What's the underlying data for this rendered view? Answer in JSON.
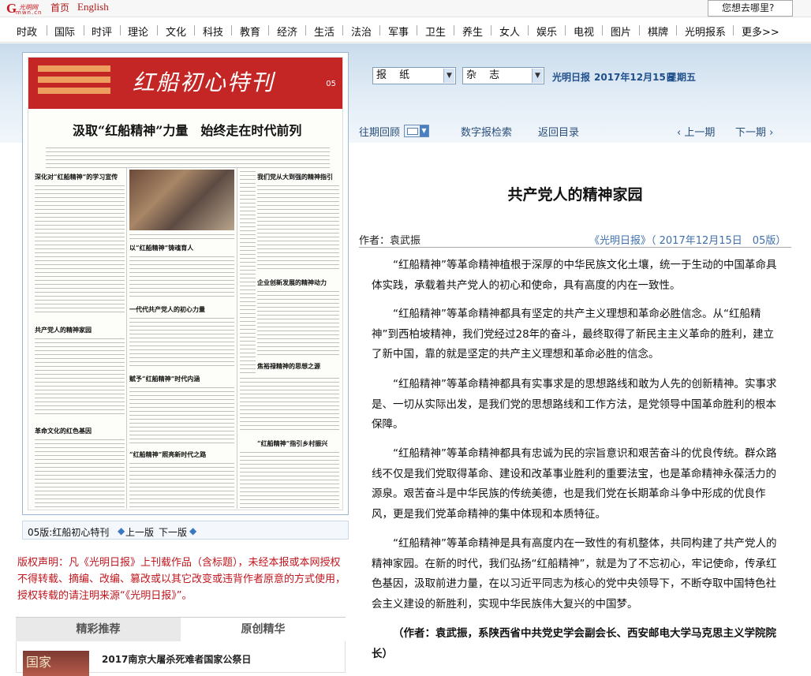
{
  "top": {
    "home": "首页",
    "english": "English",
    "search_placeholder": "您想去哪里?"
  },
  "nav": [
    "时政",
    "国际",
    "时评",
    "理论",
    "文化",
    "科技",
    "教育",
    "经济",
    "生活",
    "法治",
    "军事",
    "卫生",
    "养生",
    "女人",
    "娱乐",
    "电视",
    "图片",
    "棋牌",
    "光明报系",
    "更多>>"
  ],
  "filters": {
    "type": "报 纸",
    "name": "杂 志",
    "paper_name": "光明日报",
    "date": "2017年12月15日",
    "weekday": "星期五"
  },
  "toolbar": {
    "archive": "往期回顾",
    "digital": "数字报检索",
    "back": "返回目录",
    "prev": "‹  上一期",
    "next": "下一期  ›"
  },
  "paper": {
    "masthead_title": "红船初心特刊",
    "page_no": "05",
    "headline": "汲取“红船精神”力量　始终走在时代前列",
    "titles": [
      "深化对“红船精神”的学习宣传",
      "我们党从大到强的精神指引",
      "以“红船精神”铸魂育人",
      "企业创新发展的精神动力",
      "一代代共产党人的初心力量",
      "共产党人的精神家园",
      "焦裕禄精神的思想之源",
      "赋予“红船精神”时代内涵",
      "革命文化的红色基因",
      "“红船精神”指引乡村振兴",
      "“红船精神”照亮新时代之路"
    ]
  },
  "pagenav": {
    "label": "05版:红船初心特刊",
    "prev": "上一版",
    "next": "下一版"
  },
  "copyright": "版权声明：凡《光明日报》上刊载作品（含标题），未经本报或本网授权不得转载、摘编、改编、篡改或以其它改变或违背作者原意的方式使用，授权转载的请注明来源“《光明日报》”。",
  "tabs": {
    "recommend": "精彩推荐",
    "original": "原创精华"
  },
  "list_item": "2017南京大屠杀死难者国家公祭日",
  "thumb_text": "国家",
  "article": {
    "title": "共产党人的精神家园",
    "author": "作者：袁武振",
    "source": "《光明日报》（ 2017年12月15日　05版）",
    "paragraphs": [
      "“红船精神”等革命精神植根于深厚的中华民族文化土壤，统一于生动的中国革命具体实践，承载着共产党人的初心和使命，具有高度的内在一致性。",
      "“红船精神”等革命精神都具有坚定的共产主义理想和革命必胜信念。从“红船精神”到西柏坡精神，我们党经过28年的奋斗，最终取得了新民主主义革命的胜利，建立了新中国，靠的就是坚定的共产主义理想和革命必胜的信念。",
      "“红船精神”等革命精神都具有实事求是的思想路线和敢为人先的创新精神。实事求是、一切从实际出发，是我们党的思想路线和工作方法，是党领导中国革命胜利的根本保障。",
      "“红船精神”等革命精神都具有忠诚为民的宗旨意识和艰苦奋斗的优良传统。群众路线不仅是我们党取得革命、建设和改革事业胜利的重要法宝，也是革命精神永葆活力的源泉。艰苦奋斗是中华民族的传统美德，也是我们党在长期革命斗争中形成的优良作风，更是我们党革命精神的集中体现和本质特征。",
      "“红船精神”等革命精神是具有高度内在一致性的有机整体，共同构建了共产党人的精神家园。在新的时代，我们弘扬“红船精神”，就是为了不忘初心，牢记使命，传承红色基因，汲取前进力量，在以习近平同志为核心的党中央领导下，不断夺取中国特色社会主义建设的新胜利，实现中华民族伟大复兴的中国梦。"
    ],
    "signature": "（作者：袁武振，系陕西省中共党史学会副会长、西安邮电大学马克思主义学院院长）"
  }
}
